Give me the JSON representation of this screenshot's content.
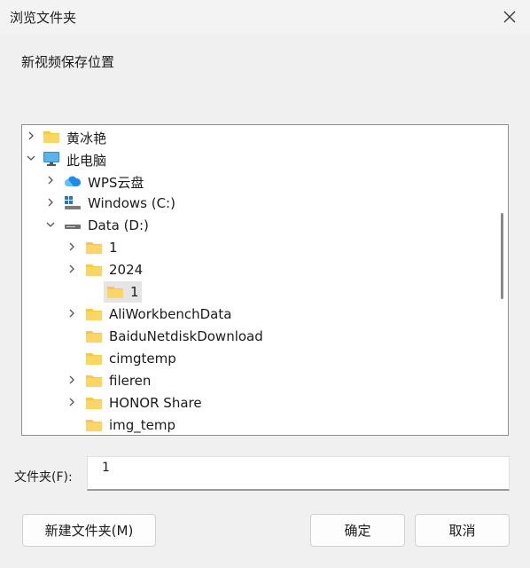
{
  "window": {
    "title": "浏览文件夹",
    "description": "新视频保存位置"
  },
  "tree": {
    "items": [
      {
        "label": "黄冰艳",
        "icon": "folder-icon",
        "expander": "collapsed"
      },
      {
        "label": "此电脑",
        "icon": "computer-icon",
        "expander": "expanded"
      },
      {
        "label": "WPS云盘",
        "icon": "cloud-icon",
        "expander": "collapsed"
      },
      {
        "label": "Windows (C:)",
        "icon": "windows-drive-icon",
        "expander": "collapsed"
      },
      {
        "label": "Data (D:)",
        "icon": "drive-icon",
        "expander": "expanded"
      },
      {
        "label": "1",
        "icon": "folder-icon",
        "expander": "collapsed"
      },
      {
        "label": "2024",
        "icon": "folder-icon",
        "expander": "expanded"
      },
      {
        "label": "1",
        "icon": "folder-icon",
        "expander": "none",
        "selected": true
      },
      {
        "label": "AliWorkbenchData",
        "icon": "folder-icon",
        "expander": "collapsed"
      },
      {
        "label": "BaiduNetdiskDownload",
        "icon": "folder-icon",
        "expander": "none"
      },
      {
        "label": "cimgtemp",
        "icon": "folder-icon",
        "expander": "none"
      },
      {
        "label": "fileren",
        "icon": "folder-icon",
        "expander": "collapsed"
      },
      {
        "label": "HONOR Share",
        "icon": "folder-icon",
        "expander": "collapsed"
      },
      {
        "label": "img_temp",
        "icon": "folder-icon",
        "expander": "none"
      }
    ]
  },
  "folder_field": {
    "label": "文件夹(F):",
    "value": "1"
  },
  "buttons": {
    "new_folder": "新建文件夹(M)",
    "ok": "确定",
    "cancel": "取消"
  },
  "colors": {
    "folder": "#f8c93c",
    "selection": "#e5e5e5",
    "window_bg": "#f0f0f0"
  }
}
